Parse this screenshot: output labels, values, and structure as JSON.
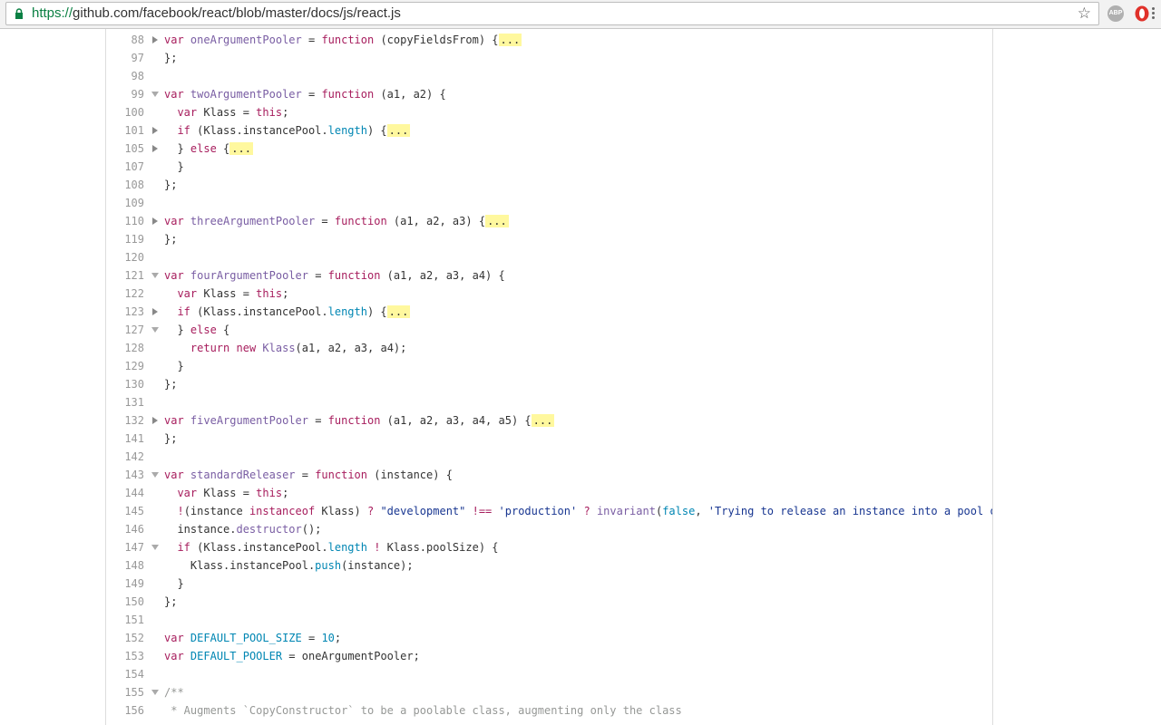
{
  "browser": {
    "url_scheme": "https://",
    "url_rest": "github.com/facebook/react/blob/master/docs/js/react.js",
    "bookmark_icon": "star-icon",
    "extensions": [
      {
        "name": "adblock-plus",
        "label": "ABP"
      },
      {
        "name": "opera-icon",
        "label": ""
      }
    ],
    "menu_icon": "kebab-menu-icon"
  },
  "colors": {
    "keyword": "#a71d5d",
    "entity": "#795da3",
    "constant": "#0086b3",
    "string": "#183691",
    "comment": "#969896",
    "fold_highlight": "#fff89e"
  },
  "code": {
    "fold_placeholder": "...",
    "lines": [
      {
        "num": "88",
        "fold": "closed"
      },
      {
        "num": "97",
        "fold": ""
      },
      {
        "num": "98",
        "fold": ""
      },
      {
        "num": "99",
        "fold": "open"
      },
      {
        "num": "100",
        "fold": ""
      },
      {
        "num": "101",
        "fold": "closed"
      },
      {
        "num": "105",
        "fold": "closed"
      },
      {
        "num": "107",
        "fold": ""
      },
      {
        "num": "108",
        "fold": ""
      },
      {
        "num": "109",
        "fold": ""
      },
      {
        "num": "110",
        "fold": "closed"
      },
      {
        "num": "119",
        "fold": ""
      },
      {
        "num": "120",
        "fold": ""
      },
      {
        "num": "121",
        "fold": "open"
      },
      {
        "num": "122",
        "fold": ""
      },
      {
        "num": "123",
        "fold": "closed"
      },
      {
        "num": "127",
        "fold": "open"
      },
      {
        "num": "128",
        "fold": ""
      },
      {
        "num": "129",
        "fold": ""
      },
      {
        "num": "130",
        "fold": ""
      },
      {
        "num": "131",
        "fold": ""
      },
      {
        "num": "132",
        "fold": "closed"
      },
      {
        "num": "141",
        "fold": ""
      },
      {
        "num": "142",
        "fold": ""
      },
      {
        "num": "143",
        "fold": "open"
      },
      {
        "num": "144",
        "fold": ""
      },
      {
        "num": "145",
        "fold": ""
      },
      {
        "num": "146",
        "fold": ""
      },
      {
        "num": "147",
        "fold": "open"
      },
      {
        "num": "148",
        "fold": ""
      },
      {
        "num": "149",
        "fold": ""
      },
      {
        "num": "150",
        "fold": ""
      },
      {
        "num": "151",
        "fold": ""
      },
      {
        "num": "152",
        "fold": ""
      },
      {
        "num": "153",
        "fold": ""
      },
      {
        "num": "154",
        "fold": ""
      },
      {
        "num": "155",
        "fold": "open"
      },
      {
        "num": "156",
        "fold": ""
      }
    ],
    "tokens": {
      "var": "var",
      "function": "function",
      "this": "this",
      "if": "if",
      "else": "else",
      "return": "return",
      "new": "new",
      "instanceof": "instanceof",
      "false": "false",
      "length": "length",
      "push": "push",
      "destructor": "destructor",
      "oneArgumentPooler": "oneArgumentPooler",
      "twoArgumentPooler": "twoArgumentPooler",
      "threeArgumentPooler": "threeArgumentPooler",
      "fourArgumentPooler": "fourArgumentPooler",
      "fiveArgumentPooler": "fiveArgumentPooler",
      "standardReleaser": "standardReleaser",
      "Klass": "Klass",
      "invariant": "invariant",
      "DEFAULT_POOL_SIZE": "DEFAULT_POOL_SIZE",
      "DEFAULT_POOLER": "DEFAULT_POOLER",
      "num10": "10",
      "str_dev": "\"development\"",
      "str_prod": "'production'",
      "str_msg": "'Trying to release an instance into a pool of a differer",
      "comment_open": "/**",
      "comment_line": " * Augments `CopyConstructor` to be a poolable class, augmenting only the class"
    }
  }
}
